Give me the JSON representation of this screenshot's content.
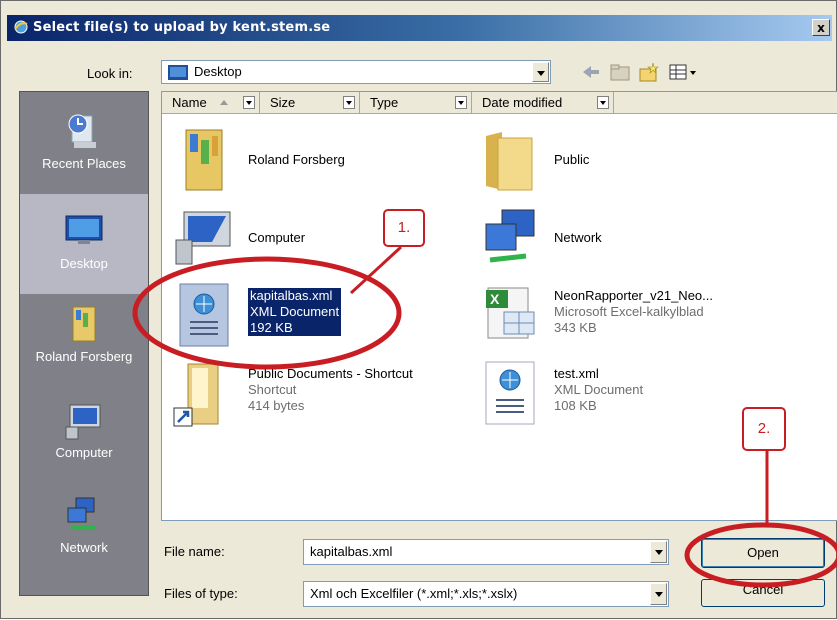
{
  "window": {
    "title": "Select file(s) to upload by kent.stem.se",
    "close_symbol": "x"
  },
  "lookin": {
    "label": "Look in:",
    "value": "Desktop"
  },
  "places": [
    {
      "label": "Recent Places",
      "icon": "recent-places-icon"
    },
    {
      "label": "Desktop",
      "icon": "desktop-icon"
    },
    {
      "label": "Roland Forsberg",
      "icon": "user-folder-icon"
    },
    {
      "label": "Computer",
      "icon": "computer-icon"
    },
    {
      "label": "Network",
      "icon": "network-icon"
    }
  ],
  "columns": [
    "Name",
    "Size",
    "Type",
    "Date modified"
  ],
  "files": [
    {
      "name": "Roland Forsberg",
      "icon": "user-folder-icon"
    },
    {
      "name": "Public",
      "icon": "folder-icon"
    },
    {
      "name": "Computer",
      "icon": "computer-icon"
    },
    {
      "name": "Network",
      "icon": "network-icon"
    },
    {
      "name": "kapitalbas.xml",
      "type": "XML Document",
      "size": "192 KB",
      "icon": "xml-document-icon",
      "selected": true
    },
    {
      "name": "NeonRapporter_v21_Neo...",
      "type": "Microsoft Excel-kalkylblad",
      "size": "343 KB",
      "icon": "excel-icon"
    },
    {
      "name": "Public Documents - Shortcut",
      "type": "Shortcut",
      "size": "414 bytes",
      "icon": "shortcut-folder-icon"
    },
    {
      "name": "test.xml",
      "type": "XML Document",
      "size": "108 KB",
      "icon": "xml-document-icon"
    }
  ],
  "form": {
    "filename_label": "File name:",
    "filename_value": "kapitalbas.xml",
    "filetype_label": "Files of type:",
    "filetype_value": "Xml och Excelfiler (*.xml;*.xls;*.xslx)"
  },
  "buttons": {
    "open": "Open",
    "cancel": "Cancel"
  },
  "annotations": {
    "step1": "1.",
    "step2": "2.",
    "color": "#c81e23"
  }
}
